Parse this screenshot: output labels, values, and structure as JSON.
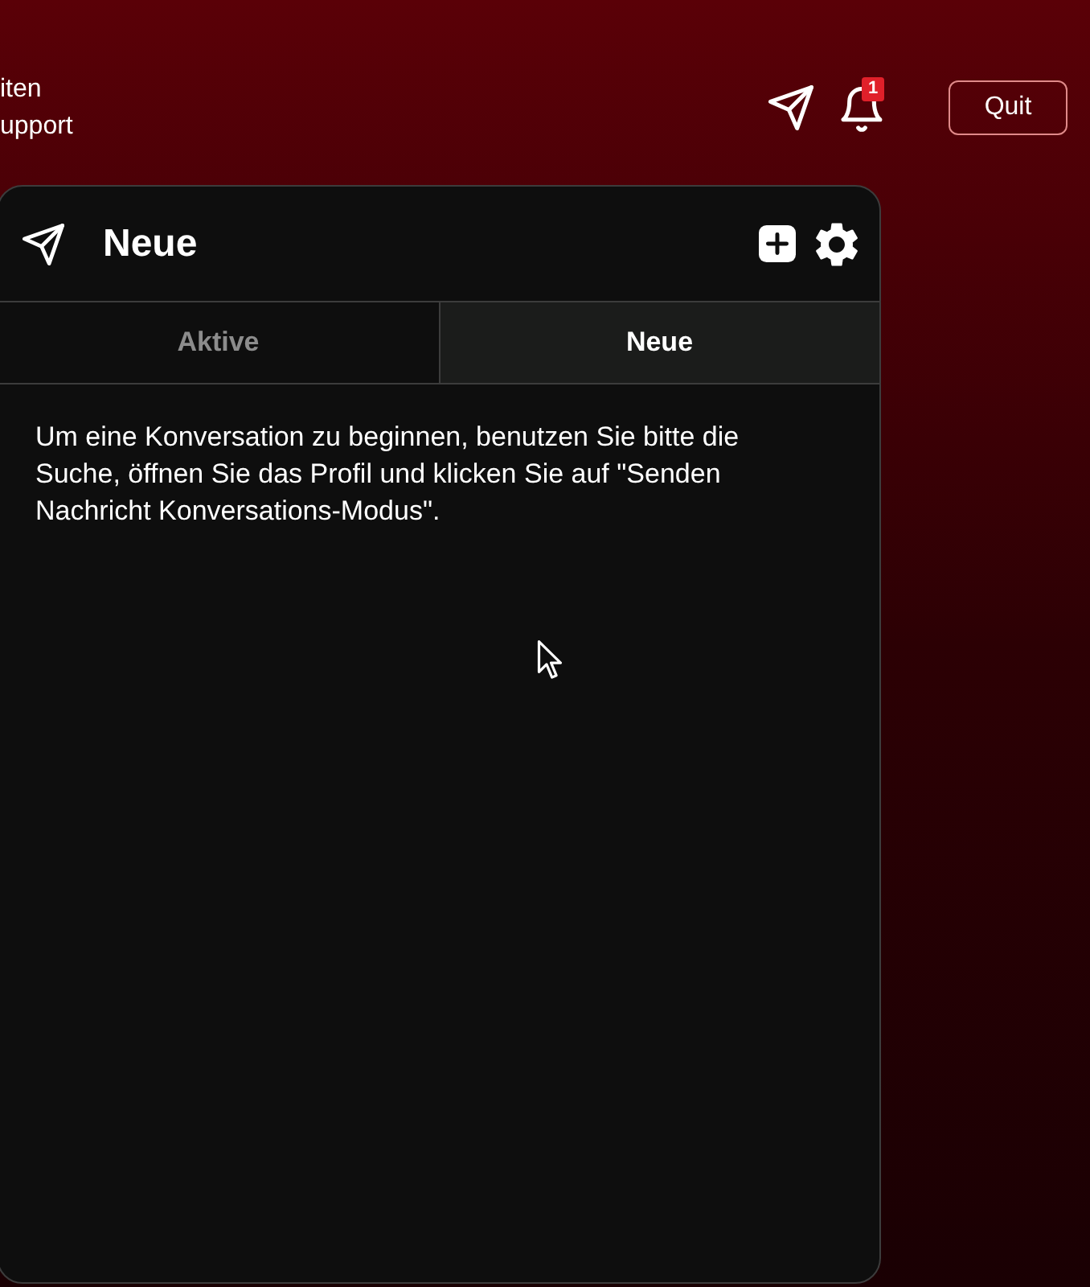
{
  "top_bar": {
    "side_links": [
      "iten",
      "upport"
    ],
    "notification_badge": "1",
    "quit_button": "Quit"
  },
  "panel": {
    "title": "Neue",
    "tabs": [
      {
        "label": "Aktive",
        "selected": false
      },
      {
        "label": "Neue",
        "selected": true
      }
    ],
    "message": "Um eine Konversation zu beginnen, benutzen Sie bitte die Suche, öffnen Sie das Profil und klicken Sie auf \"Senden Nachricht Konversations-Modus\"."
  }
}
